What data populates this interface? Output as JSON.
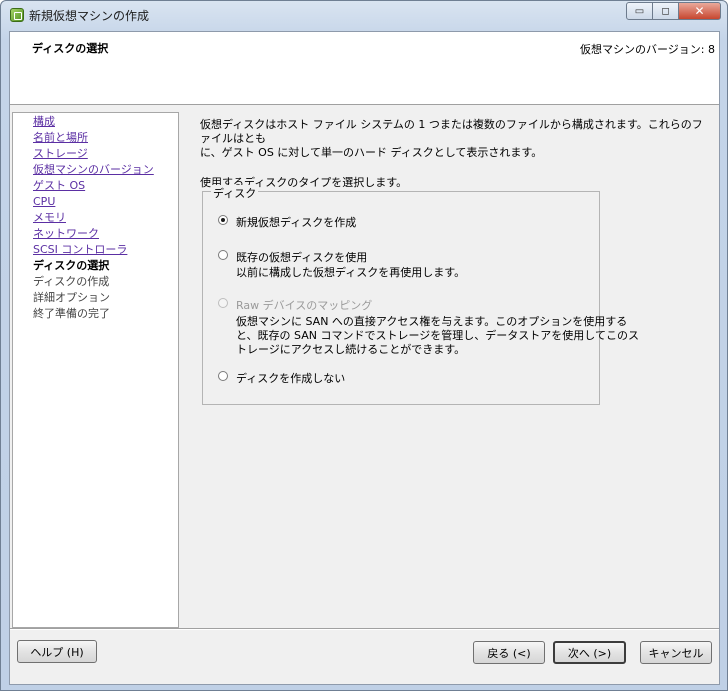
{
  "window": {
    "title": "新規仮想マシンの作成",
    "minimize_glyph": "▭",
    "maximize_glyph": "◻",
    "close_glyph": "✕"
  },
  "header": {
    "page_title": "ディスクの選択",
    "version_label": "仮想マシンのバージョン: 8"
  },
  "nav": {
    "items": [
      {
        "label": "構成",
        "state": "link"
      },
      {
        "label": "名前と場所",
        "state": "link"
      },
      {
        "label": "ストレージ",
        "state": "link"
      },
      {
        "label": "仮想マシンのバージョン",
        "state": "link"
      },
      {
        "label": "ゲスト OS",
        "state": "link"
      },
      {
        "label": "CPU",
        "state": "link"
      },
      {
        "label": "メモリ",
        "state": "link"
      },
      {
        "label": "ネットワーク",
        "state": "link"
      },
      {
        "label": "SCSI コントローラ",
        "state": "link"
      },
      {
        "label": "ディスクの選択",
        "state": "current"
      },
      {
        "label": "ディスクの作成",
        "state": "pending"
      },
      {
        "label": "詳細オプション",
        "state": "pending"
      },
      {
        "label": "終了準備の完了",
        "state": "pending"
      }
    ]
  },
  "main": {
    "description_line1": "仮想ディスクはホスト ファイル システムの 1 つまたは複数のファイルから構成されます。これらのファイルはとも",
    "description_line2": "に、ゲスト OS に対して単一のハード ディスクとして表示されます。",
    "prompt": "使用するディスクのタイプを選択します。",
    "group_label": "ディスク",
    "options": {
      "create_new": {
        "label": "新規仮想ディスクを作成",
        "selected": true
      },
      "use_existing": {
        "label": "既存の仮想ディスクを使用",
        "desc": "以前に構成した仮想ディスクを再使用します。"
      },
      "raw_mapping": {
        "label": "Raw デバイスのマッピング",
        "disabled": true,
        "desc_line1": "仮想マシンに SAN への直接アクセス権を与えます。このオプションを使用する",
        "desc_line2": "と、既存の SAN コマンドでストレージを管理し、データストアを使用してこのス",
        "desc_line3": "トレージにアクセスし続けることができます。"
      },
      "no_disk": {
        "label": "ディスクを作成しない"
      }
    }
  },
  "footer": {
    "help_label": "ヘルプ (H)",
    "back_label": "戻る (<)",
    "next_label": "次へ (>)",
    "cancel_label": "キャンセル"
  }
}
